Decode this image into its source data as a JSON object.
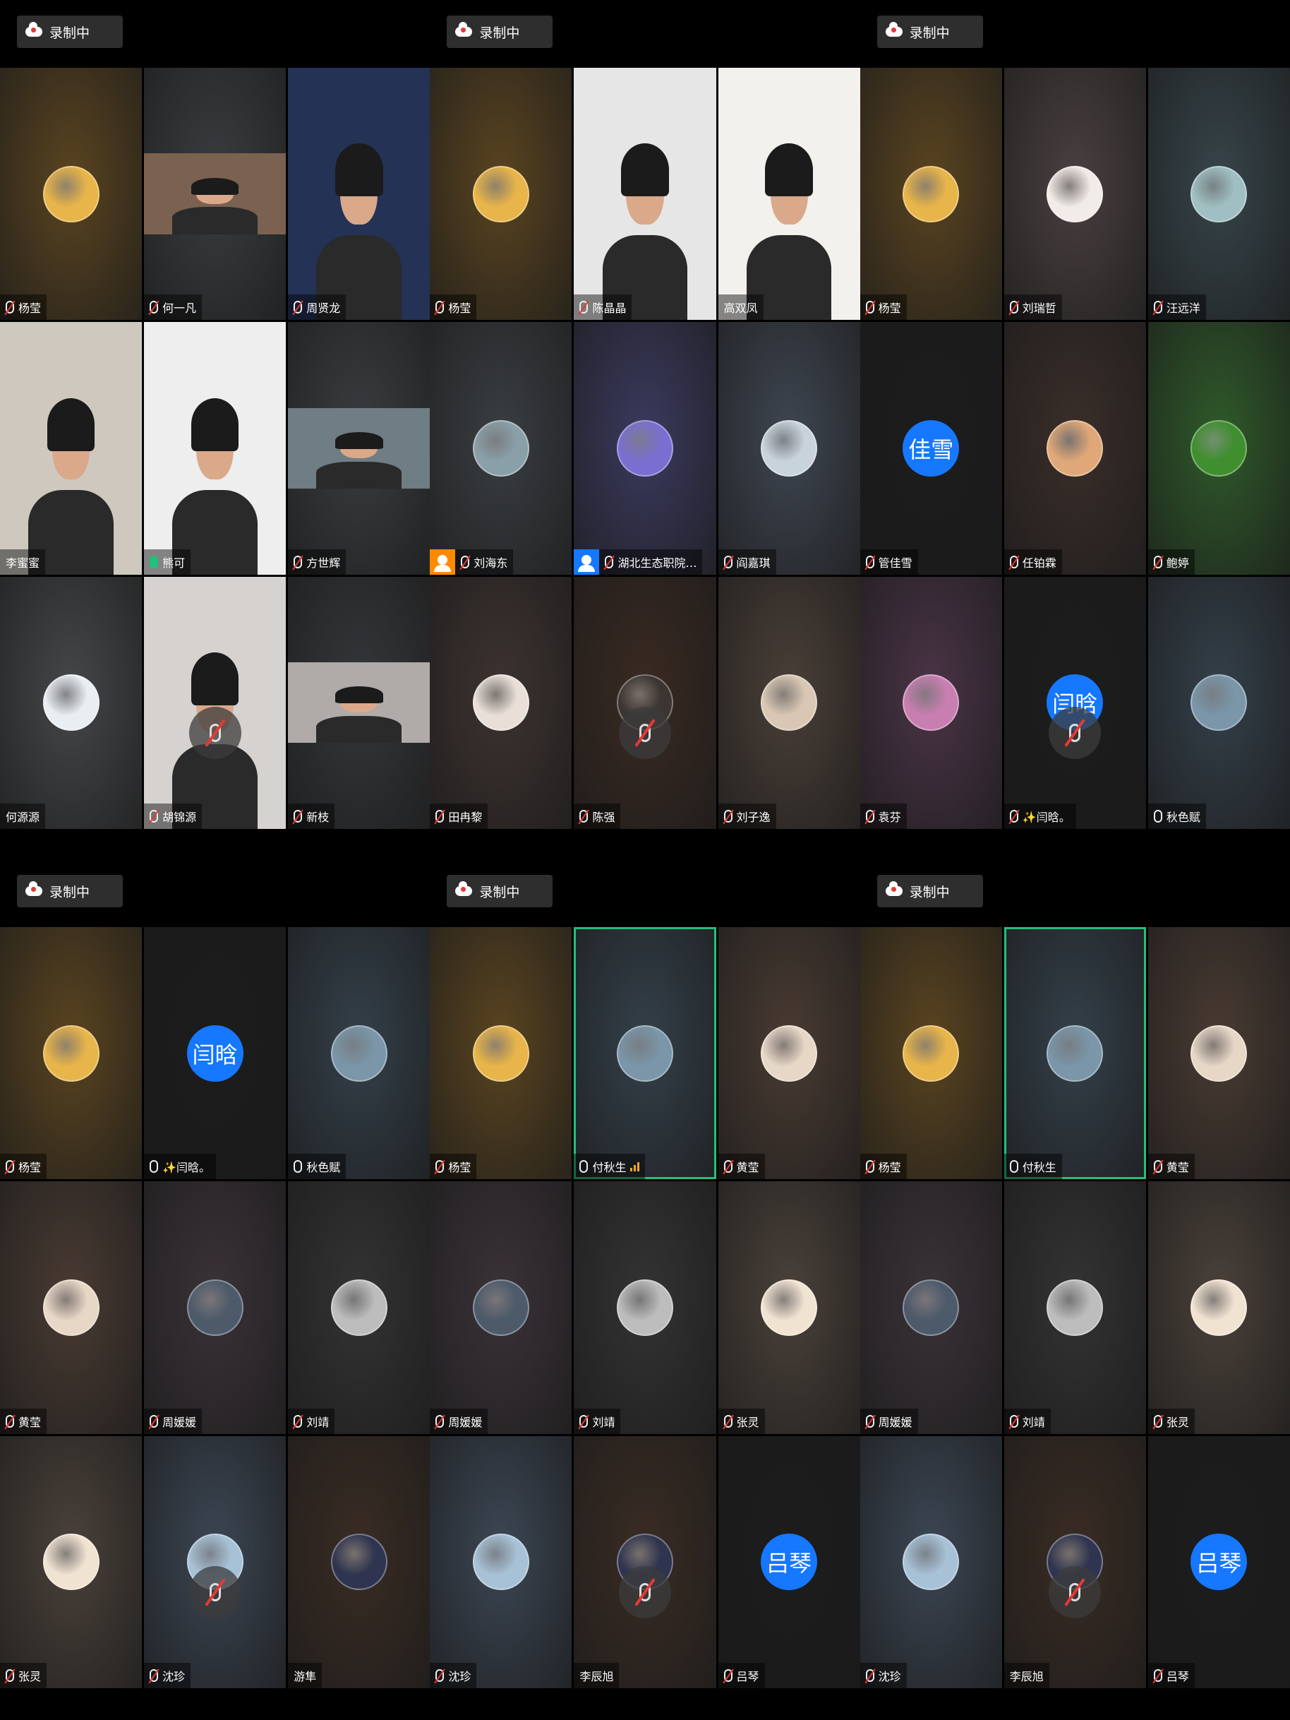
{
  "recording_label": "录制中",
  "panels": [
    {
      "tiles": [
        {
          "name": "杨莹",
          "bg": "#5a4420",
          "av": "#e8b54a",
          "mic": "muted"
        },
        {
          "name": "何一凡",
          "bg": "#3a3d40",
          "video": true,
          "vb": "#7a6150",
          "mic": "muted"
        },
        {
          "name": "周贤龙",
          "bg": "#1f2a48",
          "video": true,
          "vb": "#243256",
          "mic": "muted",
          "full": true
        },
        {
          "name": "李蜜蜜",
          "bg": "#d9d3cc",
          "video": true,
          "vb": "#cfc8bf",
          "mic": "none",
          "full": true
        },
        {
          "name": "熊可",
          "bg": "#f1f0ee",
          "video": true,
          "vb": "#eeeeee",
          "mic": "green",
          "speaking": true,
          "full": true
        },
        {
          "name": "方世辉",
          "bg": "#3a3d40",
          "video": true,
          "vb": "#6f7d84",
          "mic": "muted"
        },
        {
          "name": "何源源",
          "bg": "#45474a",
          "av": "#e9eef3",
          "mic": "none"
        },
        {
          "name": "胡锦源",
          "bg": "#cfcccf",
          "video": true,
          "vb": "#d6d2d0",
          "mic": "muted",
          "full": true,
          "bigmute": true
        },
        {
          "name": "新枝",
          "bg": "#34373a",
          "video": true,
          "vb": "#b0aaa8",
          "mic": "muted"
        }
      ]
    },
    {
      "tiles": [
        {
          "name": "杨莹",
          "bg": "#5a4420",
          "av": "#e8b54a",
          "mic": "muted"
        },
        {
          "name": "陈晶晶",
          "bg": "#cfcfcf",
          "video": true,
          "vb": "#e6e6e6",
          "mic": "muted",
          "full": true
        },
        {
          "name": "高双凤",
          "bg": "#e8e8e8",
          "video": true,
          "vb": "#f3f1ee",
          "mic": "none",
          "full": true
        },
        {
          "name": "刘海东",
          "bg": "#3a3e42",
          "av": "#8aa0a8",
          "mic": "muted",
          "host": "orange"
        },
        {
          "name": "湖北生态职院…",
          "bg": "#3b3a5e",
          "av": "#7a6fd0",
          "mic": "muted",
          "host": "blue"
        },
        {
          "name": "阎嘉琪",
          "bg": "#3f4652",
          "av": "#c9d3dc",
          "mic": "muted"
        },
        {
          "name": "田冉黎",
          "bg": "#3d3330",
          "av": "#e9dfd8",
          "mic": "muted"
        },
        {
          "name": "陈强",
          "bg": "#3a2a22",
          "av": "#3c3531",
          "mic": "muted",
          "bigmute": true
        },
        {
          "name": "刘子逸",
          "bg": "#4a3f38",
          "av": "#d9c7b3",
          "mic": "muted"
        }
      ]
    },
    {
      "tiles": [
        {
          "name": "杨莹",
          "bg": "#5a4420",
          "av": "#e8b54a",
          "mic": "muted"
        },
        {
          "name": "刘瑞哲",
          "bg": "#4a4040",
          "av": "#f2ece8",
          "mic": "muted"
        },
        {
          "name": "汪远洋",
          "bg": "#37454a",
          "av": "#9fbfc2",
          "mic": "muted"
        },
        {
          "name": "管佳雪",
          "bg": "#1c1c1c",
          "avText": "佳雪",
          "mic": "muted"
        },
        {
          "name": "任铂霖",
          "bg": "#3a2e2a",
          "av": "#e0a878",
          "mic": "muted"
        },
        {
          "name": "鲍婷",
          "bg": "#2f5a2a",
          "av": "#3f8f2f",
          "mic": "muted"
        },
        {
          "name": "袁芬",
          "bg": "#4a3446",
          "av": "#c87fb0",
          "mic": "muted"
        },
        {
          "name": "✨闫晗。",
          "bg": "#1c1c1c",
          "avText": "闫晗",
          "mic": "muted",
          "bigmute": true
        },
        {
          "name": "秋色赋",
          "bg": "#34404a",
          "av": "#7a96a8",
          "mic": "on"
        }
      ]
    },
    {
      "tiles": [
        {
          "name": "杨莹",
          "bg": "#5a4420",
          "av": "#e8b54a",
          "mic": "muted"
        },
        {
          "name": "✨闫晗。",
          "bg": "#1c1c1c",
          "avText": "闫晗",
          "mic": "on"
        },
        {
          "name": "秋色赋",
          "bg": "#34404a",
          "av": "#7a96a8",
          "mic": "on"
        },
        {
          "name": "黄莹",
          "bg": "#4a3b33",
          "av": "#e6d7c6",
          "mic": "muted"
        },
        {
          "name": "周媛媛",
          "bg": "#3a3238",
          "av": "#4c5a6a",
          "mic": "muted"
        },
        {
          "name": "刘靖",
          "bg": "#333333",
          "av": "#bdbdbd",
          "mic": "muted"
        },
        {
          "name": "张灵",
          "bg": "#4a413a",
          "av": "#f1e3d2",
          "mic": "muted"
        },
        {
          "name": "沈珍",
          "bg": "#3c4654",
          "av": "#a7c1d6",
          "mic": "muted",
          "bigmute": true
        },
        {
          "name": "游隼",
          "bg": "#3a2c24",
          "av": "#2f3550",
          "mic": "none"
        }
      ]
    },
    {
      "tiles": [
        {
          "name": "杨莹",
          "bg": "#5a4420",
          "av": "#e8b54a",
          "mic": "muted"
        },
        {
          "name": "付秋生",
          "bg": "#34404a",
          "av": "#7a96a8",
          "mic": "on",
          "speaking": true,
          "signal": true
        },
        {
          "name": "黄莹",
          "bg": "#4a3b33",
          "av": "#e6d7c6",
          "mic": "muted"
        },
        {
          "name": "周媛媛",
          "bg": "#3a3238",
          "av": "#4c5a6a",
          "mic": "muted"
        },
        {
          "name": "刘靖",
          "bg": "#333333",
          "av": "#bdbdbd",
          "mic": "muted"
        },
        {
          "name": "张灵",
          "bg": "#4a413a",
          "av": "#f1e3d2",
          "mic": "muted"
        },
        {
          "name": "沈珍",
          "bg": "#3c4654",
          "av": "#a7c1d6",
          "mic": "muted"
        },
        {
          "name": "李辰旭",
          "bg": "#3a2c24",
          "av": "#2f3550",
          "mic": "none",
          "bigmute": true
        },
        {
          "name": "吕琴",
          "bg": "#1c1c1c",
          "avText": "吕琴",
          "mic": "muted"
        }
      ]
    },
    {
      "tiles": [
        {
          "name": "杨莹",
          "bg": "#5a4420",
          "av": "#e8b54a",
          "mic": "muted"
        },
        {
          "name": "付秋生",
          "bg": "#34404a",
          "av": "#7a96a8",
          "mic": "on",
          "speaking": true
        },
        {
          "name": "黄莹",
          "bg": "#4a3b33",
          "av": "#e6d7c6",
          "mic": "muted"
        },
        {
          "name": "周媛媛",
          "bg": "#3a3238",
          "av": "#4c5a6a",
          "mic": "muted"
        },
        {
          "name": "刘靖",
          "bg": "#333333",
          "av": "#bdbdbd",
          "mic": "muted"
        },
        {
          "name": "张灵",
          "bg": "#4a413a",
          "av": "#f1e3d2",
          "mic": "muted"
        },
        {
          "name": "沈珍",
          "bg": "#3c4654",
          "av": "#a7c1d6",
          "mic": "muted"
        },
        {
          "name": "李辰旭",
          "bg": "#3a2c24",
          "av": "#2f3550",
          "mic": "none",
          "bigmute": true
        },
        {
          "name": "吕琴",
          "bg": "#1c1c1c",
          "avText": "吕琴",
          "mic": "muted"
        }
      ]
    }
  ]
}
